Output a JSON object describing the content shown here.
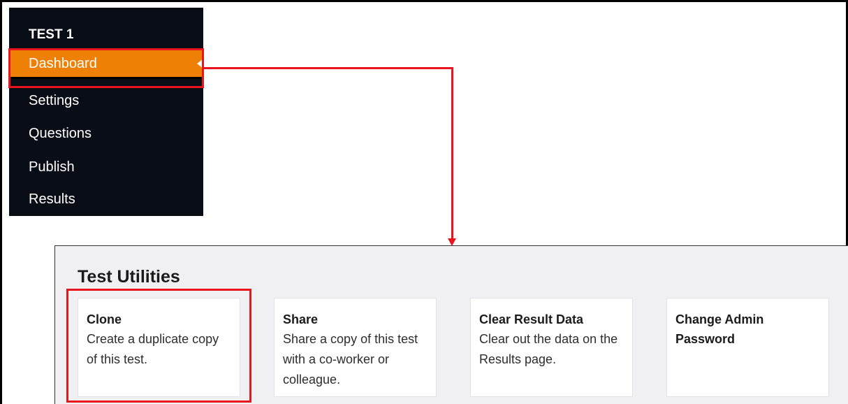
{
  "sidebar": {
    "title": "TEST 1",
    "items": [
      {
        "label": "Dashboard",
        "active": true
      },
      {
        "label": "Settings"
      },
      {
        "label": "Questions"
      },
      {
        "label": "Publish"
      },
      {
        "label": "Results"
      }
    ]
  },
  "utilities": {
    "title": "Test Utilities",
    "cards": [
      {
        "title": "Clone",
        "desc": "Create a duplicate copy of this test."
      },
      {
        "title": "Share",
        "desc": "Share a copy of this test with a co-worker or colleague."
      },
      {
        "title": "Clear Result Data",
        "desc": "Clear out the data on the Results page."
      },
      {
        "title": "Change Admin Password",
        "desc": ""
      }
    ]
  },
  "colors": {
    "sidebar_bg": "#080d16",
    "active_item": "#ef8006",
    "annotation_red": "#e8141e",
    "panel_bg": "#f0f0f2"
  }
}
